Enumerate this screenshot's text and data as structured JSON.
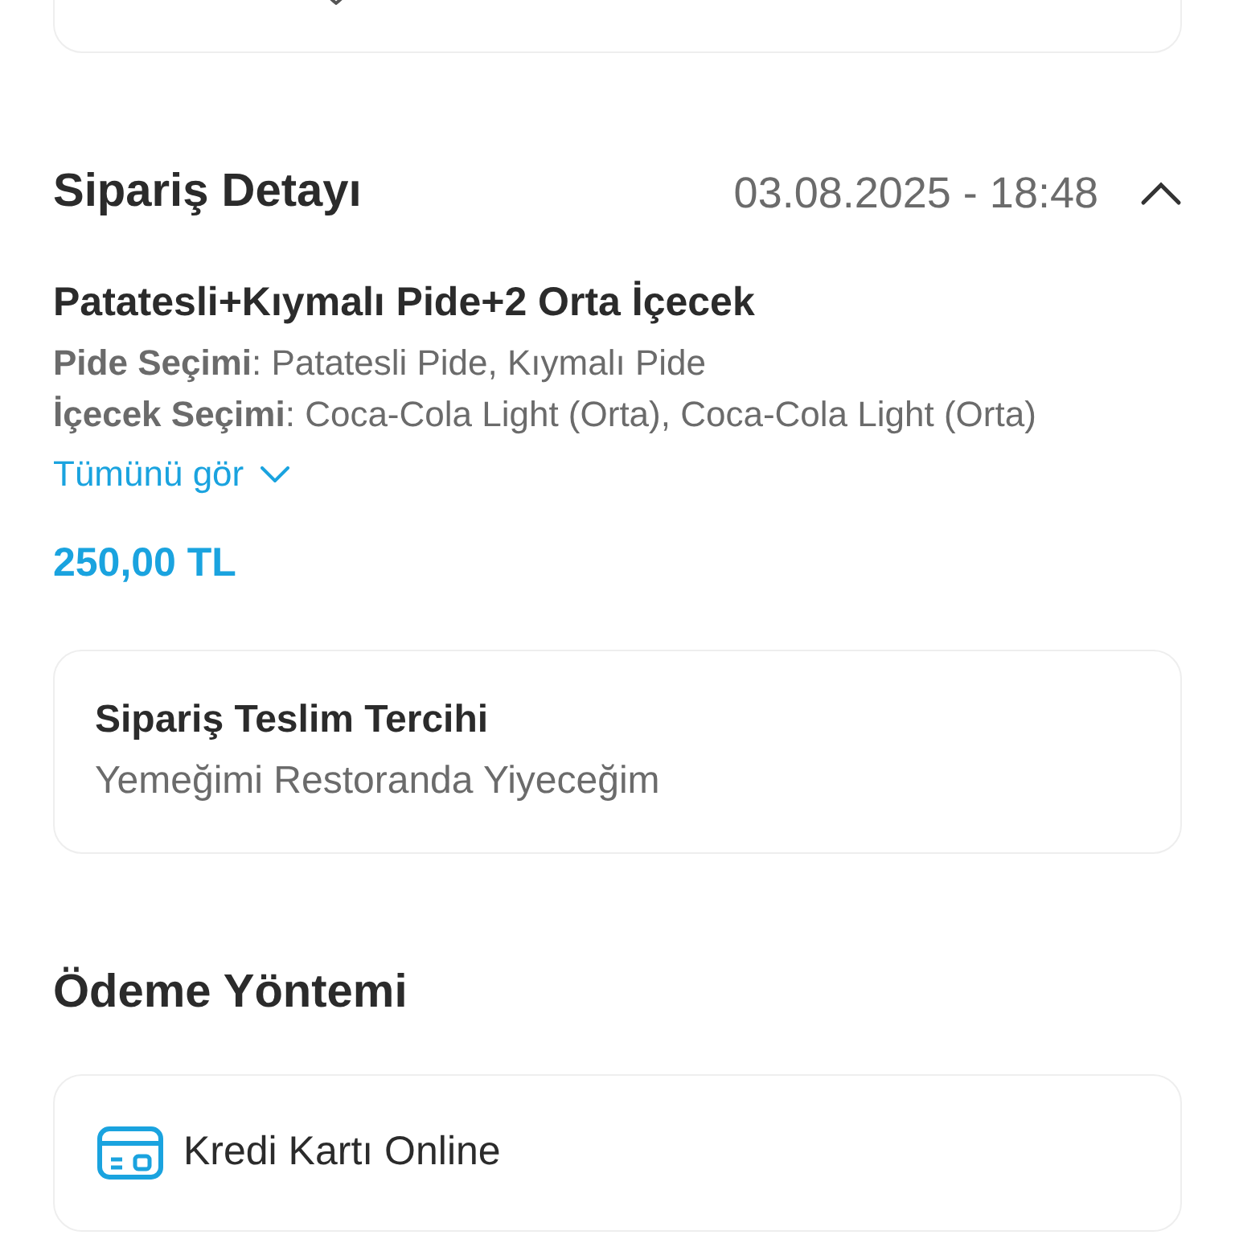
{
  "order_detail": {
    "title": "Sipariş Detayı",
    "datetime": "03.08.2025 - 18:48",
    "expanded": true,
    "item": {
      "name": "Patatesli+Kıymalı Pide+2 Orta İçecek",
      "options": [
        "**Pide Seçimi**: Patatesli Pide, Kıymalı Pide",
        "**İçecek Seçimi**: Coca-Cola Light (Orta), Coca-Cola Light (Orta)"
      ],
      "see_all": "Tümünü gör",
      "price": "250,00 TL"
    }
  },
  "delivery_preference": {
    "title": "Sipariş Teslim Tercihi",
    "value": "Yemeğimi Restoranda Yiyeceğim"
  },
  "payment": {
    "title": "Ödeme Yöntemi",
    "method": "Kredi Kartı Online"
  }
}
